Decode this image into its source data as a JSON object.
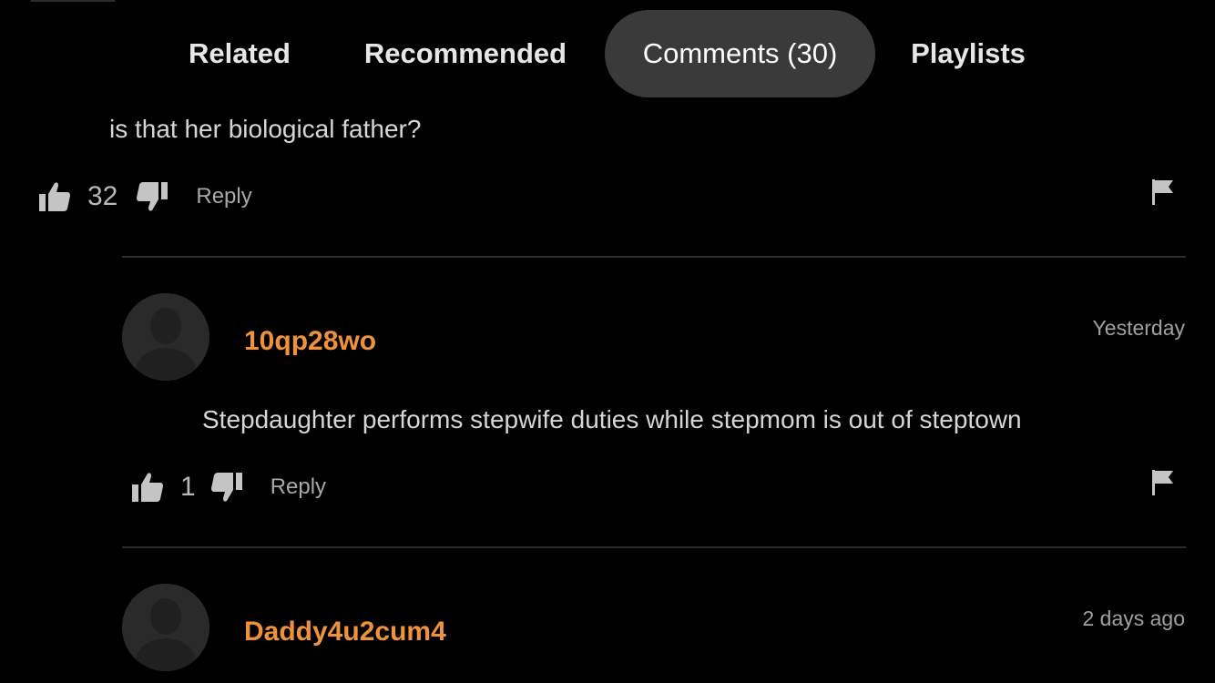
{
  "tabs": [
    {
      "label": "Related",
      "active": false
    },
    {
      "label": "Recommended",
      "active": false
    },
    {
      "label": "Comments (30)",
      "active": true
    },
    {
      "label": "Playlists",
      "active": false
    }
  ],
  "comments": [
    {
      "text": "is that her biological father?",
      "likes": "32",
      "reply_label": "Reply"
    },
    {
      "username": "10qp28wo",
      "timestamp": "Yesterday",
      "text": "Stepdaughter performs stepwife duties while stepmom is out of steptown",
      "likes": "1",
      "reply_label": "Reply"
    },
    {
      "username": "Daddy4u2cum4",
      "timestamp": "2 days ago"
    }
  ],
  "colors": {
    "background": "#000000",
    "username": "#f0923a",
    "active_tab": "#3a3a3a"
  },
  "icons": [
    "thumbs-up-icon",
    "thumbs-down-icon",
    "flag-icon",
    "avatar-placeholder-icon"
  ]
}
